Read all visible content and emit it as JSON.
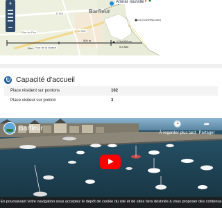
{
  "map": {
    "zoom_in": "+",
    "zoom_out": "−",
    "town_label": "Barfleur",
    "road_labels": [
      "D 901",
      "D 902",
      "Rue du Pou",
      "Rue de la Masse"
    ],
    "poi_label": "Amiral Tourville",
    "depth_labels": [
      "Ort.(0.2kn/HW(Lower)",
      "0.2kn/HWLow"
    ],
    "scale_labels": [
      "1km",
      "500 m",
      "0.5 NM"
    ]
  },
  "capacity": {
    "title": "Capacité d'accueil",
    "rows": [
      {
        "label": "Place résident sur pontons",
        "value": "102"
      },
      {
        "label": "Place visiteur sur ponton",
        "value": "3"
      }
    ]
  },
  "video": {
    "channel_title": "Barfleur",
    "watch_later": "À regarder plus tard",
    "share": "Partager"
  },
  "cookie": {
    "text": "En poursuivant votre navigation sous acceptez le dépôt de cookie du site et de sites tiers destinés à vous proposer des contenus"
  },
  "colors": {
    "accent": "#1f5d9e",
    "play_button": "#ff0000",
    "map_land": "#e9ecd9",
    "map_sea": "#ffffff"
  }
}
